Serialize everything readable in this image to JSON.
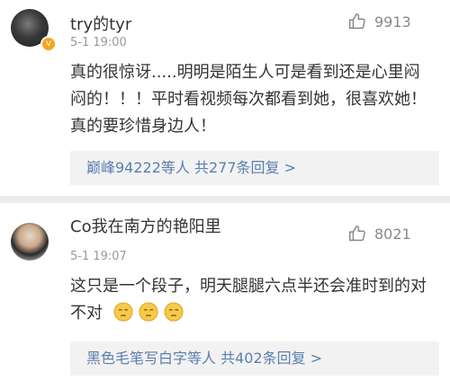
{
  "comments": [
    {
      "username": "try的tyr",
      "time": "5-1 19:00",
      "likes": "9913",
      "text": "真的很惊讶.....明明是陌生人可是看到还是心里闷闷的！！！平时看视频每次都看到她，很喜欢她！真的要珍惜身边人！",
      "reply_summary": "巅峰94222等人  共277条回复 >",
      "verified_badge": "v"
    },
    {
      "username": "Co我在南方的艳阳里",
      "time": "5-1 19:07",
      "likes": "8021",
      "text": "这只是一个段子，明天腿腿六点半还会准时到的对不对",
      "emoji_count": 3,
      "reply_summary": "黑色毛笔写白字等人  共402条回复 >"
    }
  ],
  "colors": {
    "link": "#5a7fae",
    "meta": "#999999",
    "badge": "#f5a623",
    "reply_bg": "#f2f2f2"
  },
  "icons": {
    "like": "thumbs-up-icon",
    "emoji": "sad-face-emoji-icon"
  }
}
